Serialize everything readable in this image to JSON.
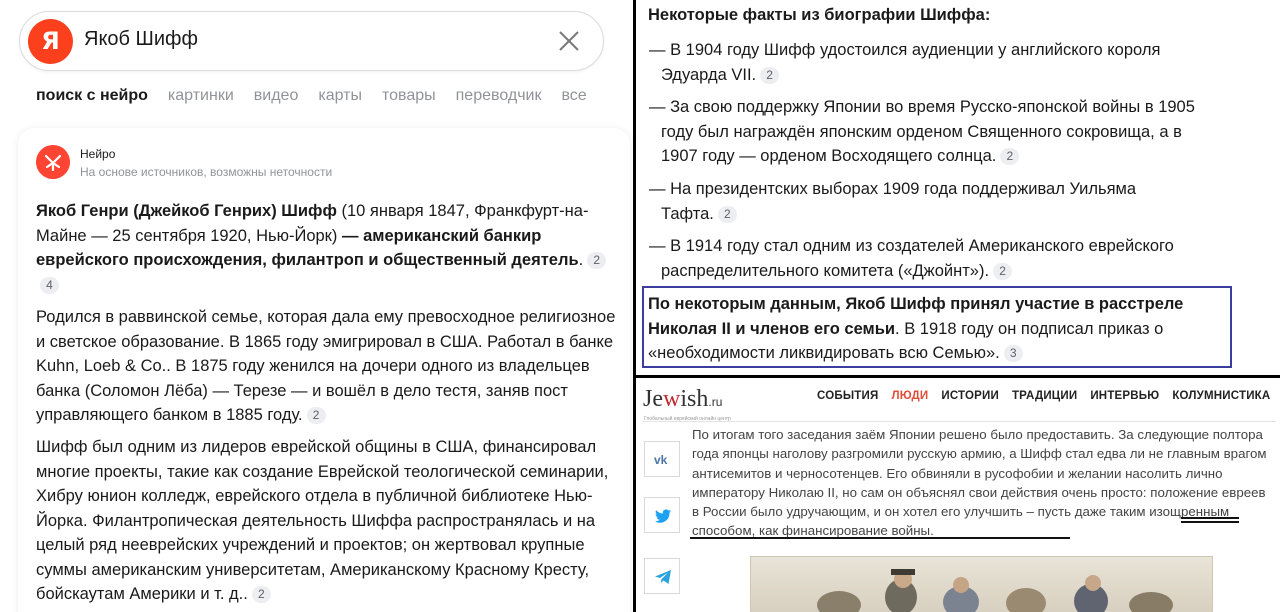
{
  "search": {
    "logo": "Я",
    "query": "Якоб Шифф"
  },
  "tabs": [
    {
      "label": "поиск с нейро"
    },
    {
      "label": "картинки"
    },
    {
      "label": "видео"
    },
    {
      "label": "карты"
    },
    {
      "label": "товары"
    },
    {
      "label": "переводчик"
    },
    {
      "label": "все"
    }
  ],
  "neuro": {
    "title": "Нейро",
    "subtitle": "На основе источников, возможны неточности",
    "p1": {
      "b1": "Якоб Генри (Джейкоб Генрих) Шифф",
      "t1": " (10 января 1847, Франкфурт-на-Майне — 25 сентября 1920, Нью-Йорк) ",
      "b2": "— американский банкир еврейского происхождения, филантроп и общественный деятель",
      "t2": ".",
      "refs": [
        "2",
        "4"
      ]
    },
    "p2": {
      "text": "Родился в раввинской семье, которая дала ему превосходное религиозное и светское образование. В 1865 году эмигрировал в США. Работал в банке Kuhn, Loeb & Co.. В 1875 году женился на дочери одного из владельцев банка (Соломон Лёба) — Терезе — и вошёл в дело тестя, заняв пост управляющего банком в 1885 году.",
      "ref": "2"
    },
    "p3": {
      "text": "Шифф был одним из лидеров еврейской общины в США, финансировал многие проекты, такие как создание Еврейской теологической семинарии, Хибру юнион колледж, еврейского отдела в публичной библиотеке Нью-Йорка. Филантропическая деятельность Шиффа распространялась и на целый ряд нееврейских учреждений и проектов; он жертвовал крупные суммы американским университетам, Американскому Красному Кресту, бойскаутам Америки и т. д..",
      "ref": "2"
    }
  },
  "facts": {
    "heading": "Некоторые факты из биографии Шиффа:",
    "items": [
      {
        "line1": "— В 1904 году Шифф удостоился аудиенции у английского короля",
        "cont": "Эдуарда VII.",
        "ref": "2"
      },
      {
        "line1": "— За свою поддержку Японии во время Русско-японской войны в 1905",
        "cont": "году был награждён японским орденом Священного сокровища, а в",
        "cont2": "1907 году — орденом Восходящего солнца.",
        "ref": "2"
      },
      {
        "line1": "— На президентских выборах 1909 года поддерживал Уильяма",
        "cont": "Тафта.",
        "ref": "2"
      },
      {
        "line1": "— В 1914 году стал одним из создателей Американского еврейского",
        "cont": "распределительного комитета («Джойнт»).",
        "ref": "2"
      }
    ],
    "highlight": {
      "bold": "По некоторым данным, Якоб Шифф принял участие в расстреле Николая II и членов его семьи",
      "text": ". В 1918 году он подписал приказ о «необходимости ликвидировать всю Семью».",
      "ref": "3"
    }
  },
  "jewish": {
    "logo_main": "Je",
    "logo_w": "w",
    "logo_rest": "ish",
    "logo_ru": ".ru",
    "tagline": "Глобальный еврейский онлайн центр",
    "nav": [
      {
        "label": "СОБЫТИЯ",
        "active": false
      },
      {
        "label": "ЛЮДИ",
        "active": true
      },
      {
        "label": "ИСТОРИИ",
        "active": false
      },
      {
        "label": "ТРАДИЦИИ",
        "active": false
      },
      {
        "label": "ИНТЕРВЬЮ",
        "active": false
      },
      {
        "label": "КОЛУМНИСТИКА",
        "active": false
      }
    ],
    "article": "По итогам того заседания заём Японии решено было предоставить. За следующие полтора года японцы наголову разгромили русскую армию, а Шифф стал едва ли не главным врагом антисемитов и черносотенцев. Его обвиняли в русофобии и желании насолить лично императору Николаю II, но сам он объяснял свои действия очень просто: положение евреев в России было удручающим, и он хотел его улучшить – пусть даже таким изощренным способом, как финансирование войны.",
    "accent_color": "#e04e3a"
  },
  "colors": {
    "yandex_red": "#fc3f1d",
    "highlight_border": "#3a3d9c"
  }
}
